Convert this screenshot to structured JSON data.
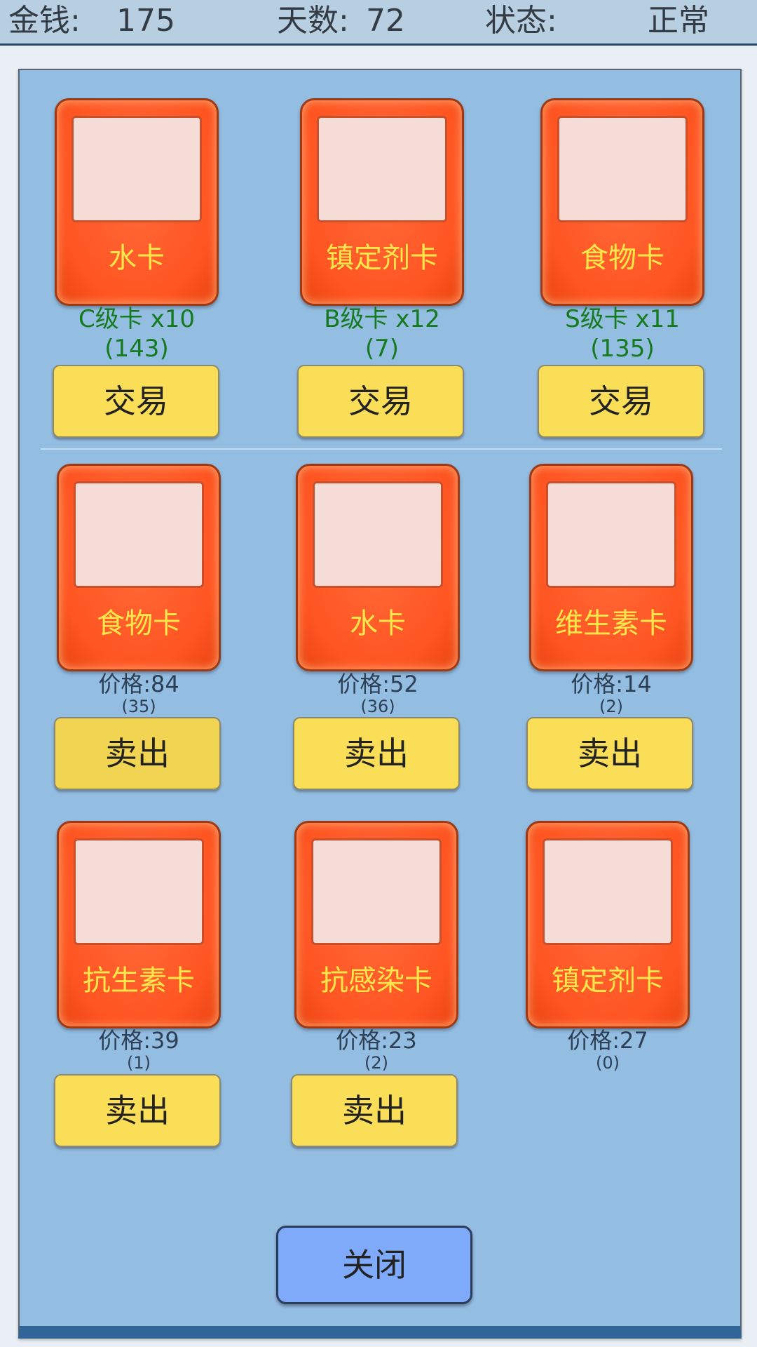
{
  "header": {
    "money_label": "金钱:",
    "money_value": "175",
    "days_label": "天数:",
    "days_value": "72",
    "status_label": "状态:",
    "status_value": "正常"
  },
  "trade_cards": [
    {
      "name": "水卡",
      "grade": "C级卡 x10",
      "count": "(143)",
      "button": "交易"
    },
    {
      "name": "镇定剂卡",
      "grade": "B级卡 x12",
      "count": "(7)",
      "button": "交易"
    },
    {
      "name": "食物卡",
      "grade": "S级卡 x11",
      "count": "(135)",
      "button": "交易"
    }
  ],
  "sell_cards": [
    {
      "name": "食物卡",
      "price": "价格:84",
      "count": "(35)",
      "button": "卖出"
    },
    {
      "name": "水卡",
      "price": "价格:52",
      "count": "(36)",
      "button": "卖出"
    },
    {
      "name": "维生素卡",
      "price": "价格:14",
      "count": "(2)",
      "button": "卖出"
    },
    {
      "name": "抗生素卡",
      "price": "价格:39",
      "count": "(1)",
      "button": "卖出"
    },
    {
      "name": "抗感染卡",
      "price": "价格:23",
      "count": "(2)",
      "button": "卖出"
    },
    {
      "name": "镇定剂卡",
      "price": "价格:27",
      "count": "(0)"
    }
  ],
  "close_button": "关闭",
  "colors": {
    "card_face": "#ff5522",
    "card_name": "#fde84c",
    "button_yellow": "#fbde58",
    "close_button": "#7faaf9",
    "panel": "#94bde2",
    "grade_text": "#157a1f"
  }
}
